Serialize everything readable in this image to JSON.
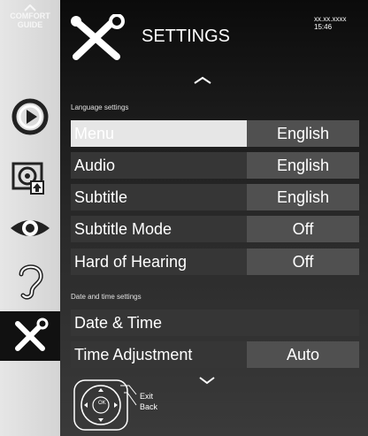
{
  "sidebar": {
    "comfort_line1": "COMFORT",
    "comfort_line2": "GUIDE",
    "items": [
      {
        "icon": "play-circle-icon"
      },
      {
        "icon": "media-icon"
      },
      {
        "icon": "eye-icon"
      },
      {
        "icon": "ear-icon"
      },
      {
        "icon": "tools-icon",
        "active": true
      }
    ]
  },
  "header": {
    "title": "SETTINGS",
    "date": "xx.xx.xxxx",
    "time": "15:46"
  },
  "sections": {
    "language": "Language settings",
    "datetime": "Date and time settings"
  },
  "language_rows": [
    {
      "label": "Menu",
      "value": "English",
      "selected": true
    },
    {
      "label": "Audio",
      "value": "English"
    },
    {
      "label": "Subtitle",
      "value": "English"
    },
    {
      "label": "Subtitle Mode",
      "value": "Off"
    },
    {
      "label": "Hard of Hearing",
      "value": "Off"
    }
  ],
  "datetime_rows": [
    {
      "label": "Date & Time",
      "value": ""
    },
    {
      "label": "Time Adjustment",
      "value": "Auto"
    }
  ],
  "footer": {
    "ok": "OK",
    "exit": "Exit",
    "back": "Back"
  },
  "colors": {
    "selected_row": "#e6e6e6",
    "row_bg": "#363636",
    "value_bg": "#505050",
    "sidebar_bg": "#dcdcdc"
  }
}
